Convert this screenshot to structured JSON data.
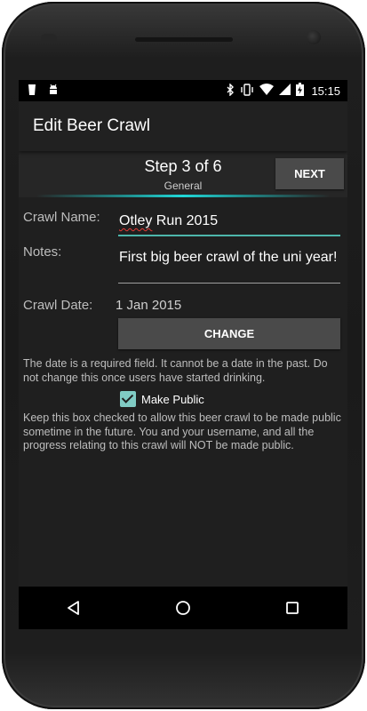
{
  "status_bar": {
    "time": "15:15",
    "left_icons": [
      "beer-notification-icon",
      "android-debug-icon"
    ],
    "right_icons": [
      "bluetooth-icon",
      "vibrate-icon",
      "wifi-icon",
      "cell-signal-icon",
      "battery-charging-icon"
    ]
  },
  "action_bar": {
    "title": "Edit Beer Crawl"
  },
  "stepper": {
    "title": "Step 3 of 6",
    "subtitle": "General",
    "next_label": "NEXT"
  },
  "form": {
    "crawl_name_label": "Crawl Name:",
    "crawl_name_misspelled": "Otley",
    "crawl_name_rest": " Run 2015",
    "notes_label": "Notes:",
    "notes_value": "First big beer crawl of the uni year!",
    "crawl_date_label": "Crawl Date:",
    "crawl_date_value": "1 Jan 2015",
    "change_label": "CHANGE",
    "date_help": "The date is a required field. It cannot be a date in the past. Do not change this once users have started drinking.",
    "make_public_label": "Make Public",
    "make_public_checked": true,
    "public_help": "Keep this box checked to allow this beer crawl to be made public sometime in the future. You and your username, and all the progress relating to this crawl will NOT be made public."
  },
  "colors": {
    "accent": "#4db6ac",
    "checkbox": "#80cbc4",
    "progress": "#20d8d8"
  }
}
